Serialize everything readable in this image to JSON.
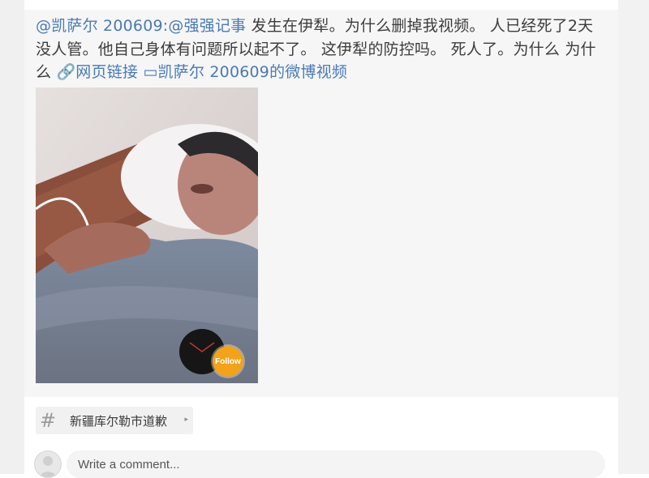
{
  "post": {
    "segments": [
      {
        "text": "@凯萨尔 200609:@强强记事",
        "kind": "link"
      },
      {
        "text": " 发生在伊犁。为什么删掉我视频。 人已经死了2天没人管。他自己身体有问题所以起不了。 这伊犁的防控吗。 死人了。为什么 为什么 ",
        "kind": "plain"
      },
      {
        "text": "🔗网页链接",
        "kind": "link"
      },
      {
        "text": " ",
        "kind": "plain"
      },
      {
        "text": "▭凯萨尔 200609的微博视频",
        "kind": "link"
      }
    ],
    "media": {
      "follow_label": "Follow"
    }
  },
  "topic": {
    "hash": "#",
    "label": "新疆库尔勒市道歉",
    "arrow": "▸"
  },
  "comment": {
    "placeholder": "Write a comment..."
  },
  "colors": {
    "link": "#4a7ab5",
    "text": "#3c3c3c",
    "follow_badge": "#f2a31a"
  }
}
